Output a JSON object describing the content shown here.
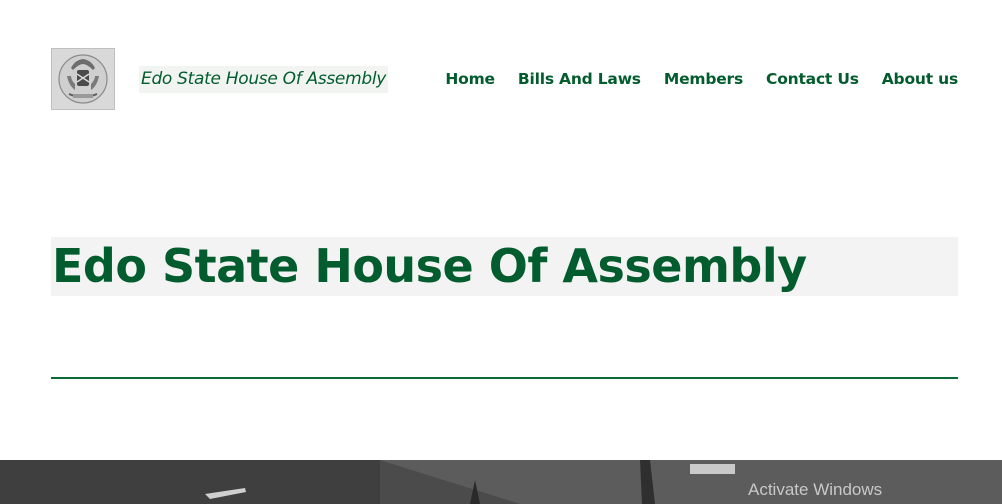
{
  "header": {
    "site_name": "Edo State House Of Assembly",
    "nav": [
      {
        "label": "Home"
      },
      {
        "label": "Bills And Laws"
      },
      {
        "label": "Members"
      },
      {
        "label": "Contact Us"
      },
      {
        "label": "About us"
      }
    ],
    "logo_icon": "coat-of-arms-icon"
  },
  "hero": {
    "title": "Edo State House Of Assembly"
  },
  "overlay": {
    "activate_windows": "Activate Windows"
  },
  "colors": {
    "brand_green": "#035c2e",
    "divider_green": "#0b6b36"
  }
}
